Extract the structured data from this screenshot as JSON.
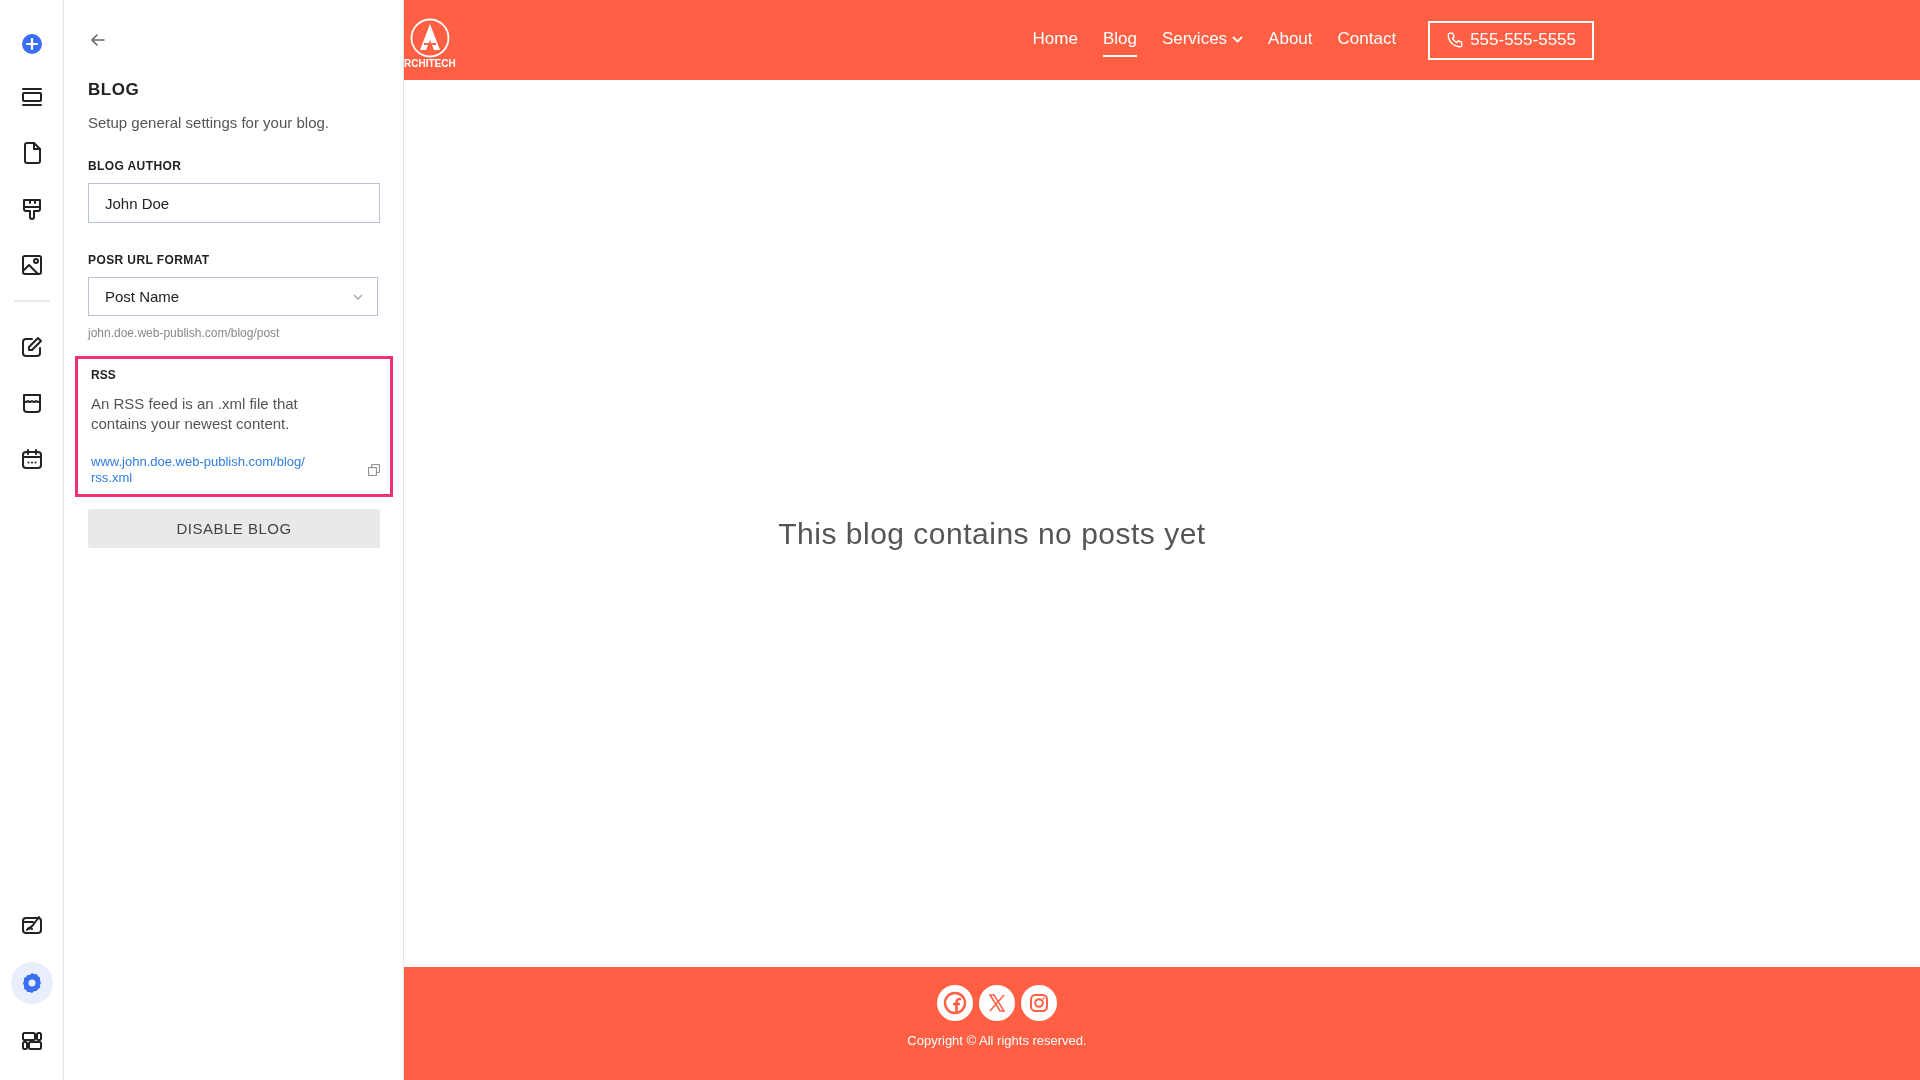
{
  "rail": {
    "groups": [
      [
        {
          "selected": false
        },
        {
          "selected": false
        },
        {
          "selected": false
        },
        {
          "selected": false
        }
      ],
      [
        {
          "selected": false
        },
        {
          "selected": false
        },
        {
          "selected": false
        }
      ],
      [
        {
          "selected": false
        },
        {
          "selected": true
        },
        {
          "selected": false
        }
      ]
    ]
  },
  "panel": {
    "title": "BLOG",
    "description": "Setup general settings for your blog.",
    "author": {
      "label": "BLOG AUTHOR",
      "value": "John Doe"
    },
    "url_format": {
      "label": "POSR URL FORMAT",
      "value": "Post Name",
      "hint": "john.doe.web-publish.com/blog/post"
    },
    "rss": {
      "label": "RSS",
      "highlighted": true,
      "description": "An RSS feed is an .xml file that contains your newest content.",
      "link": "www.john.doe.web-publish.com/blog/ rss.xml"
    },
    "disable_button": "DISABLE BLOG"
  },
  "site": {
    "logo_text": "RCHITECH",
    "nav": [
      {
        "label": "Home",
        "selected": false,
        "dropdown": false
      },
      {
        "label": "Blog",
        "selected": true,
        "dropdown": false
      },
      {
        "label": "Services",
        "selected": false,
        "dropdown": true
      },
      {
        "label": "About",
        "selected": false,
        "dropdown": false
      },
      {
        "label": "Contact",
        "selected": false,
        "dropdown": false
      }
    ],
    "phone": "555-555-5555",
    "empty_message": "This blog contains no posts yet",
    "copyright": "Copyright © All rights reserved."
  }
}
